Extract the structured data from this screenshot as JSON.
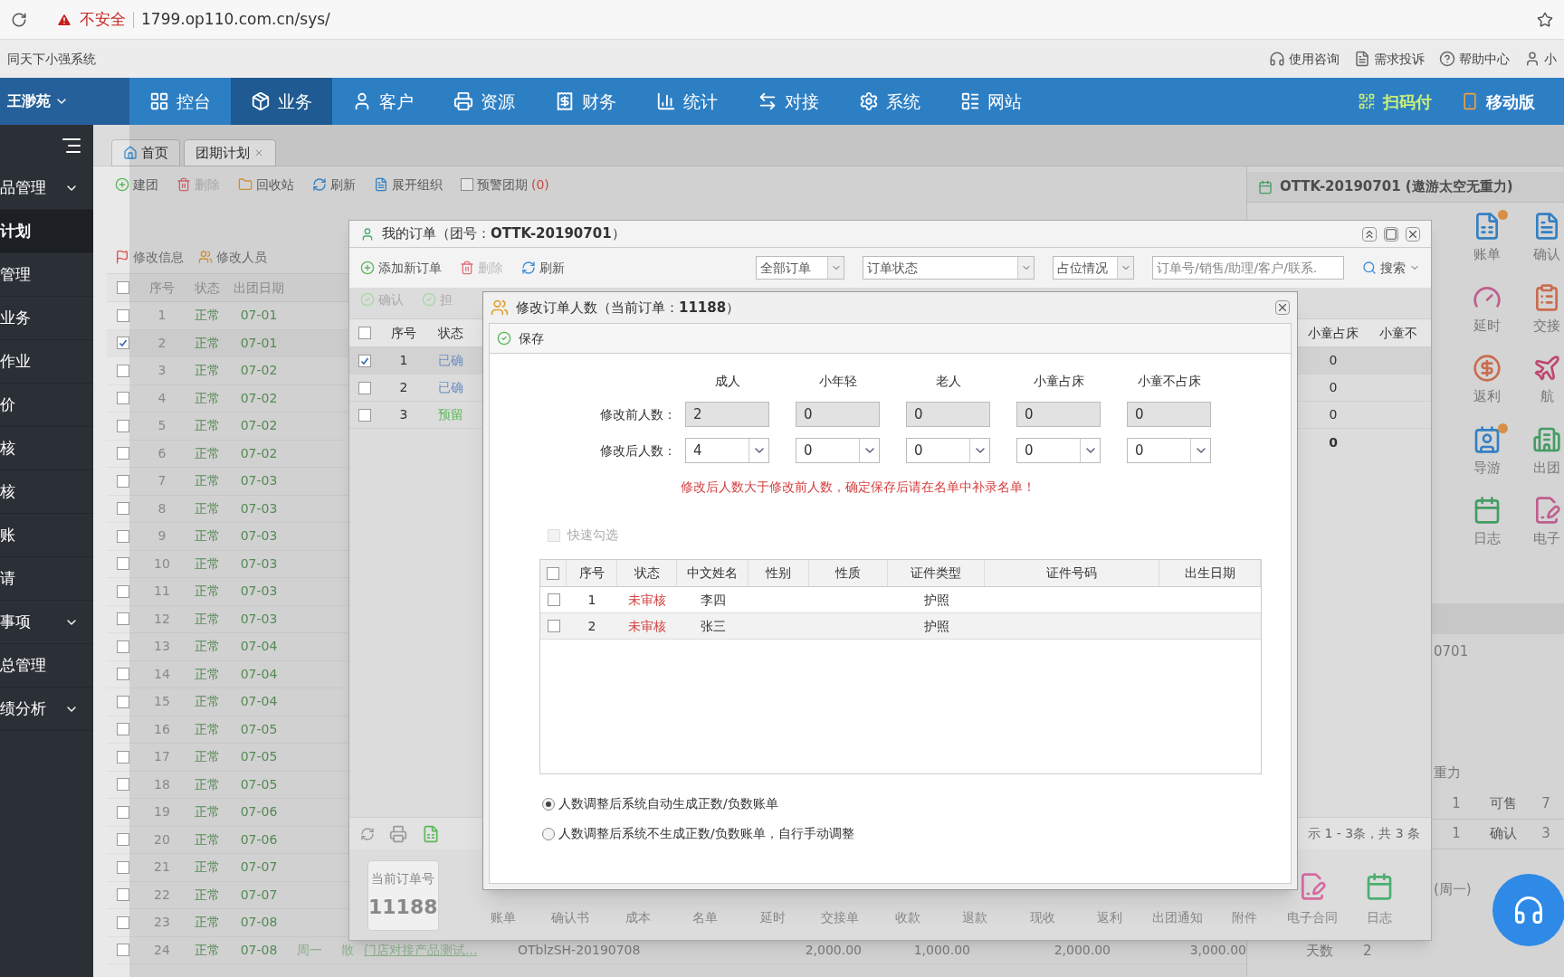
{
  "browser": {
    "security_label": "不安全",
    "url": "1799.op110.com.cn/sys/"
  },
  "topbar": {
    "system_name": "同天下小强系统",
    "links": [
      "使用咨询",
      "需求投诉",
      "帮助中心",
      "小"
    ]
  },
  "navbar": {
    "user": "王渺苑",
    "items": [
      {
        "label": "控台",
        "selected": false
      },
      {
        "label": "业务",
        "selected": true
      },
      {
        "label": "客户",
        "selected": false
      },
      {
        "label": "资源",
        "selected": false
      },
      {
        "label": "财务",
        "selected": false
      },
      {
        "label": "统计",
        "selected": false
      },
      {
        "label": "对接",
        "selected": false
      },
      {
        "label": "系统",
        "selected": false
      },
      {
        "label": "网站",
        "selected": false
      }
    ],
    "right_items": [
      "扫码付",
      "移动版"
    ]
  },
  "sidebar": {
    "items": [
      {
        "label": "品管理",
        "expandable": true,
        "selected": false
      },
      {
        "label": "计划",
        "expandable": false,
        "selected": true
      },
      {
        "label": "管理",
        "expandable": false,
        "selected": false
      },
      {
        "label": "业务",
        "expandable": false,
        "selected": false
      },
      {
        "label": "作业",
        "expandable": false,
        "selected": false
      },
      {
        "label": "价",
        "expandable": false,
        "selected": false
      },
      {
        "label": "核",
        "expandable": false,
        "selected": false
      },
      {
        "label": "核",
        "expandable": false,
        "selected": false
      },
      {
        "label": "账",
        "expandable": false,
        "selected": false
      },
      {
        "label": "请",
        "expandable": false,
        "selected": false
      },
      {
        "label": "事项",
        "expandable": true,
        "selected": false
      },
      {
        "label": "总管理",
        "expandable": false,
        "selected": false
      },
      {
        "label": "绩分析",
        "expandable": true,
        "selected": false
      }
    ]
  },
  "tabs": [
    {
      "label": "首页",
      "selected": false
    },
    {
      "label": "团期计划",
      "selected": true
    }
  ],
  "toolbar": {
    "items": [
      {
        "label": "建团",
        "disabled": false
      },
      {
        "label": "删除",
        "disabled": true
      },
      {
        "label": "回收站",
        "disabled": false
      },
      {
        "label": "刷新",
        "disabled": false
      },
      {
        "label": "展开组织",
        "disabled": false
      }
    ],
    "warning": {
      "label": "预警团期",
      "count": "(0)",
      "checked": false
    }
  },
  "secondary_toolbar": [
    "修改信息",
    "修改人员"
  ],
  "group_table": {
    "columns": [
      "序号",
      "状态",
      "出团日期"
    ],
    "all_checked": false,
    "rows": [
      {
        "no": "1",
        "status": "正常",
        "date": "07-01",
        "checked": false
      },
      {
        "no": "2",
        "status": "正常",
        "date": "07-01",
        "checked": true
      },
      {
        "no": "3",
        "status": "正常",
        "date": "07-02",
        "checked": false
      },
      {
        "no": "4",
        "status": "正常",
        "date": "07-02",
        "checked": false
      },
      {
        "no": "5",
        "status": "正常",
        "date": "07-02",
        "checked": false
      },
      {
        "no": "6",
        "status": "正常",
        "date": "07-02",
        "checked": false
      },
      {
        "no": "7",
        "status": "正常",
        "date": "07-03",
        "checked": false
      },
      {
        "no": "8",
        "status": "正常",
        "date": "07-03",
        "checked": false
      },
      {
        "no": "9",
        "status": "正常",
        "date": "07-03",
        "checked": false
      },
      {
        "no": "10",
        "status": "正常",
        "date": "07-03",
        "checked": false
      },
      {
        "no": "11",
        "status": "正常",
        "date": "07-03",
        "checked": false
      },
      {
        "no": "12",
        "status": "正常",
        "date": "07-03",
        "checked": false
      },
      {
        "no": "13",
        "status": "正常",
        "date": "07-04",
        "checked": false
      },
      {
        "no": "14",
        "status": "正常",
        "date": "07-04",
        "checked": false
      },
      {
        "no": "15",
        "status": "正常",
        "date": "07-04",
        "checked": false
      },
      {
        "no": "16",
        "status": "正常",
        "date": "07-05",
        "checked": false
      },
      {
        "no": "17",
        "status": "正常",
        "date": "07-05",
        "checked": false
      },
      {
        "no": "18",
        "status": "正常",
        "date": "07-05",
        "checked": false
      },
      {
        "no": "19",
        "status": "正常",
        "date": "07-06",
        "checked": false
      },
      {
        "no": "20",
        "status": "正常",
        "date": "07-06",
        "checked": false
      },
      {
        "no": "21",
        "status": "正常",
        "date": "07-07",
        "checked": false
      },
      {
        "no": "22",
        "status": "正常",
        "date": "07-07",
        "checked": false
      },
      {
        "no": "23",
        "status": "正常",
        "date": "07-08",
        "checked": false
      },
      {
        "no": "24",
        "status": "正常",
        "date": "07-08",
        "checked": false,
        "extra": [
          "周一",
          "散",
          "门店对接产品测试...",
          "OTblzSH-20190708",
          "2,000.00",
          "1,000.00",
          "2,000.00",
          "3,000.00"
        ]
      }
    ]
  },
  "tour_panel": {
    "title": "OTTK-20190701 (遨游太空无重力)",
    "actions": [
      {
        "label": "账单",
        "badge": true
      },
      {
        "label": "确认",
        "badge": false
      },
      {
        "label": "延时",
        "badge": false
      },
      {
        "label": "交接",
        "badge": false
      },
      {
        "label": "返利",
        "badge": false
      },
      {
        "label": "航",
        "badge": false
      },
      {
        "label": "导游",
        "badge": true
      },
      {
        "label": "出团",
        "badge": false
      },
      {
        "label": "日志",
        "badge": false
      },
      {
        "label": "电子",
        "badge": false
      }
    ],
    "code_fragment": "0701",
    "name_fragment": "重力",
    "stats": [
      {
        "value": "1",
        "label": "可售",
        "count": "7"
      },
      {
        "value": "1",
        "label": "确认",
        "count": "3"
      }
    ],
    "weekday": "(周一)",
    "days_label": "天数",
    "days": "2"
  },
  "order_window": {
    "title": "我的订单（团号：**OTTK-20190701**）",
    "toolbar": [
      {
        "label": "添加新订单",
        "disabled": false
      },
      {
        "label": "删除",
        "disabled": true
      },
      {
        "label": "刷新",
        "disabled": false
      }
    ],
    "filters": [
      "全部订单",
      "订单状态",
      "占位情况"
    ],
    "search": {
      "placeholder": "订单号/销售/助理/客户/联系.",
      "button": "搜索"
    },
    "actions": [
      "确认",
      "担"
    ],
    "left_columns": [
      "序号",
      "状态"
    ],
    "right_columns": [
      "小童占床",
      "小童不"
    ],
    "rows": [
      {
        "checked": true,
        "no": "1",
        "status": "已确",
        "color": "#6b8fc0",
        "child_bed": "0"
      },
      {
        "checked": false,
        "no": "2",
        "status": "已确",
        "color": "#6b8fc0",
        "child_bed": "0"
      },
      {
        "checked": false,
        "no": "3",
        "status": "预留",
        "color": "#5cb85c",
        "child_bed": "0"
      }
    ],
    "all_checked": false,
    "total_child_bed": "0",
    "pager": "示 1 - 3条，共 3 条",
    "current_order_label": "当前订单号",
    "current_order": "11188",
    "bottom_actions": [
      {
        "label": "账单",
        "kind": "label"
      },
      {
        "label": "确认书",
        "kind": "label"
      },
      {
        "label": "成本",
        "kind": "label"
      },
      {
        "label": "名单",
        "kind": "label"
      },
      {
        "label": "延时",
        "kind": "label"
      },
      {
        "label": "交接单",
        "kind": "label"
      },
      {
        "label": "收款",
        "kind": "label"
      },
      {
        "label": "退款",
        "kind": "label"
      },
      {
        "label": "现收",
        "kind": "label"
      },
      {
        "label": "返利",
        "kind": "label"
      },
      {
        "label": "出团通知",
        "kind": "label"
      },
      {
        "label": "附件",
        "kind": "label"
      },
      {
        "label": "电子合同",
        "kind": "contract"
      },
      {
        "label": "日志",
        "kind": "log"
      }
    ]
  },
  "dialog": {
    "title": "修改订单人数（当前订单：**11188**）",
    "save": "保存",
    "columns": [
      "成人",
      "小年轻",
      "老人",
      "小童占床",
      "小童不占床"
    ],
    "before": {
      "label": "修改前人数：",
      "values": [
        "2",
        "0",
        "0",
        "0",
        "0"
      ]
    },
    "after": {
      "label": "修改后人数：",
      "values": [
        "4",
        "0",
        "0",
        "0",
        "0"
      ]
    },
    "warning": "修改后人数大于修改前人数，确定保存后请在名单中补录名单！",
    "quick_select": {
      "label": "快速勾选",
      "checked": false,
      "disabled": true
    },
    "table": {
      "columns": [
        "序号",
        "状态",
        "中文姓名",
        "性别",
        "性质",
        "证件类型",
        "证件号码",
        "出生日期"
      ],
      "all_checked": false,
      "rows": [
        {
          "checked": false,
          "no": "1",
          "status": "未审核",
          "name": "李四",
          "id_type": "护照"
        },
        {
          "checked": false,
          "no": "2",
          "status": "未审核",
          "name": "张三",
          "id_type": "护照"
        }
      ]
    },
    "options": [
      {
        "label": "人数调整后系统自动生成正数/负数账单",
        "selected": true
      },
      {
        "label": "人数调整后系统不生成正数/负数账单，自行手动调整",
        "selected": false
      }
    ]
  }
}
